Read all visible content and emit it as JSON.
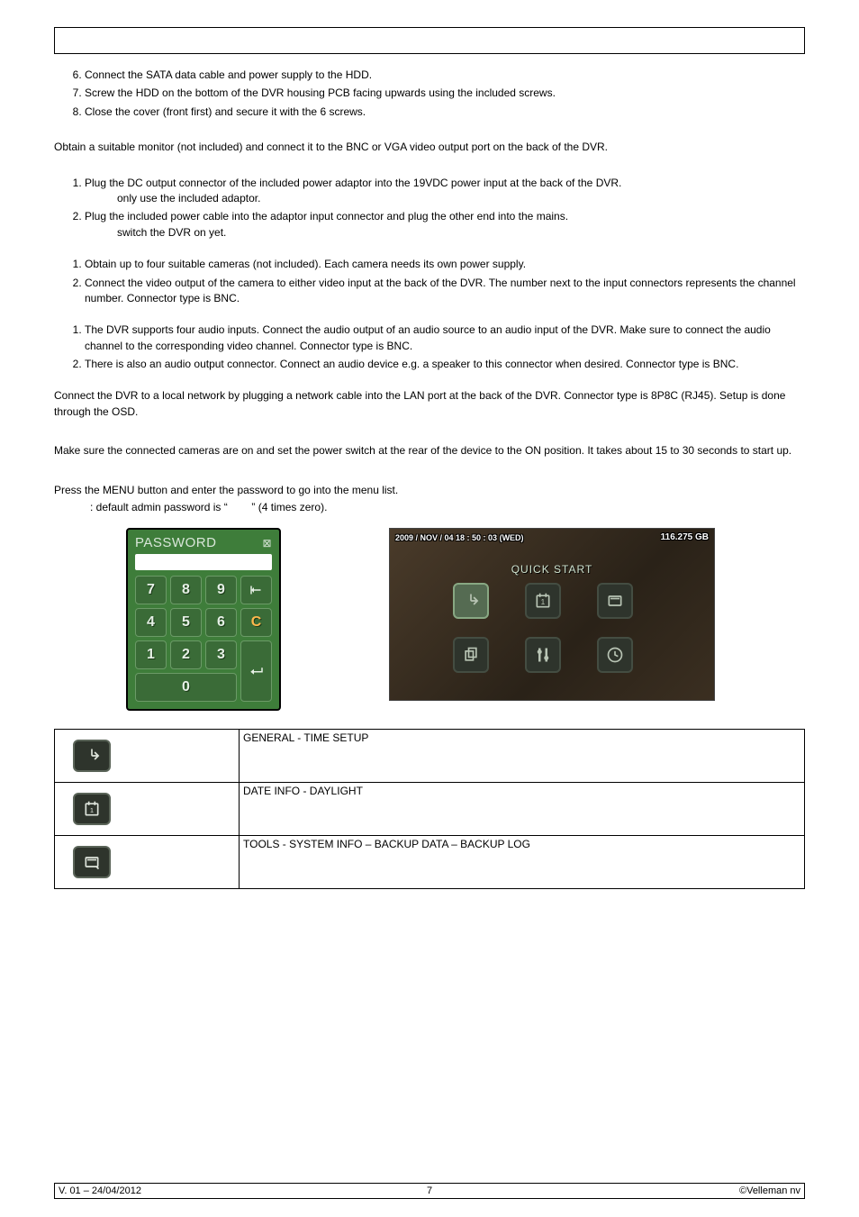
{
  "list1": {
    "start": 6,
    "items": [
      "Connect the SATA data cable and power supply to the HDD.",
      "Screw the HDD on the bottom of the DVR housing PCB facing upwards using the included screws.",
      "Close the cover (front first) and secure it with the 6 screws."
    ]
  },
  "monitor_text": "Obtain a suitable monitor (not included) and connect it to the BNC or VGA video output port on the back of the DVR.",
  "list2": {
    "start": 1,
    "items": [
      "Plug the DC output connector of the included power adaptor into the 19VDC power input at the back of the DVR.",
      "Plug the included power cable into the adaptor input connector and plug the other end into the mains."
    ],
    "sub1": " only use the included adaptor.",
    "sub2": " switch the DVR on yet."
  },
  "list3": {
    "start": 1,
    "items": [
      "Obtain up to four suitable cameras (not included). Each camera needs its own power supply.",
      "Connect the video output of the camera to either video input at the back of the DVR. The number next to the input connectors represents the channel number. Connector type is BNC."
    ]
  },
  "list4": {
    "start": 1,
    "items": [
      "The DVR supports four audio inputs. Connect the audio output of an audio source to an audio input of the DVR. Make sure to connect the audio channel to the corresponding video channel. Connector type is BNC.",
      "There is also an audio output connector. Connect an audio device e.g. a speaker to this connector when desired. Connector type is BNC."
    ]
  },
  "network_text": "Connect the DVR to a local network by plugging a network cable into the LAN port at the back of the DVR. Connector type is 8P8C (RJ45). Setup is done through the OSD.",
  "power_on_text": "Make sure the connected cameras are on and set the power switch at the rear of the device to the ON position. It takes about 15 to 30 seconds to start up.",
  "menu_intro": "Press the MENU button and enter the password to go into the menu list.",
  "menu_note_prefix": ": default admin password is “",
  "menu_note_suffix": "” (4 times zero).",
  "password": {
    "title": "PASSWORD",
    "keys": [
      "7",
      "8",
      "9",
      "",
      "4",
      "5",
      "6",
      "C",
      "1",
      "2",
      "3",
      "",
      "0"
    ],
    "clear": "C"
  },
  "quick_start": {
    "date_line": "2009 / NOV / 04 18 : 50 : 03 (WED)",
    "size": "116.275 GB",
    "title": "QUICK START"
  },
  "menu_table": [
    {
      "desc": "GENERAL - TIME SETUP"
    },
    {
      "desc": "DATE INFO - DAYLIGHT"
    },
    {
      "desc": "TOOLS - SYSTEM INFO – BACKUP DATA – BACKUP LOG"
    }
  ],
  "footer": {
    "left": "V. 01 – 24/04/2012",
    "center": "7",
    "right": "©Velleman nv"
  }
}
